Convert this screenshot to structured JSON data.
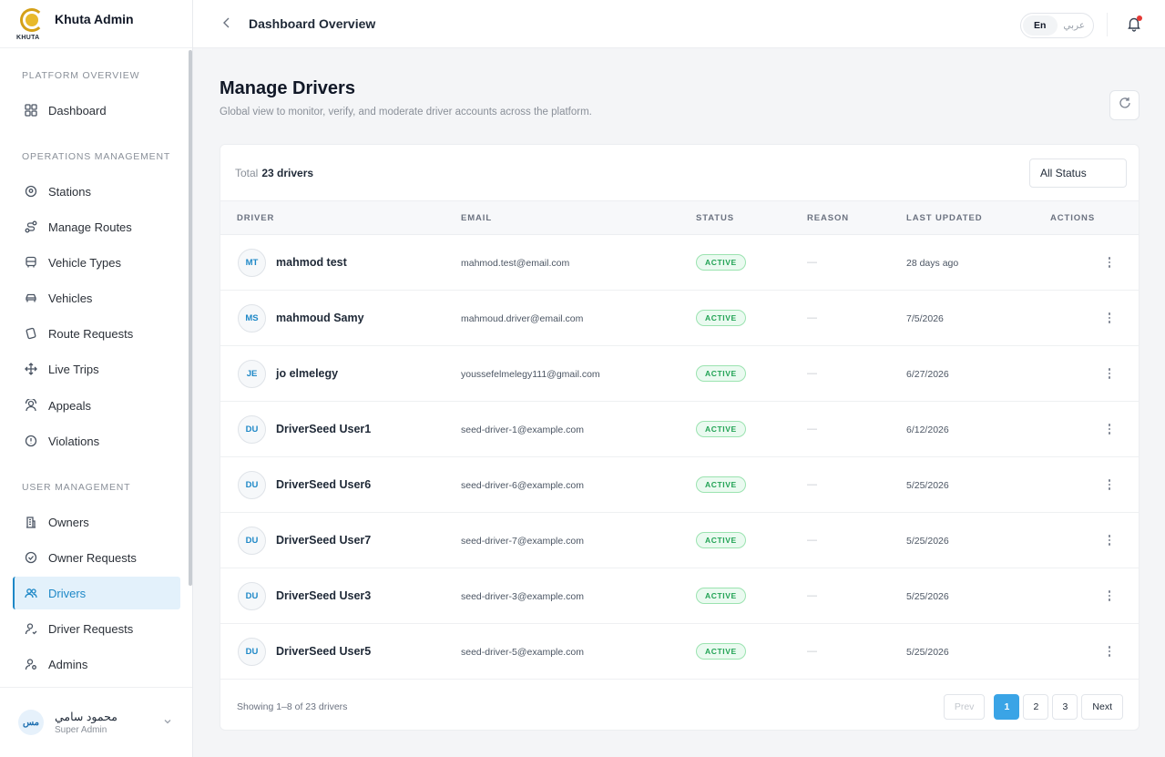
{
  "brand": {
    "title": "Khuta Admin",
    "logo_text": "KHUTA"
  },
  "sidebar": {
    "sections": [
      {
        "label": "PLATFORM OVERVIEW"
      },
      {
        "label": "OPERATIONS MANAGEMENT"
      },
      {
        "label": "USER MANAGEMENT"
      }
    ],
    "items": [
      {
        "label": "Dashboard",
        "icon": "grid-icon"
      },
      {
        "label": "Stations",
        "icon": "map-pin-icon"
      },
      {
        "label": "Manage Routes",
        "icon": "route-icon"
      },
      {
        "label": "Vehicle Types",
        "icon": "bus-icon"
      },
      {
        "label": "Vehicles",
        "icon": "car-icon"
      },
      {
        "label": "Route Requests",
        "icon": "tag-icon"
      },
      {
        "label": "Live Trips",
        "icon": "move-icon"
      },
      {
        "label": "Appeals",
        "icon": "users-ring-icon"
      },
      {
        "label": "Violations",
        "icon": "alert-circle-icon"
      },
      {
        "label": "Owners",
        "icon": "building-icon"
      },
      {
        "label": "Owner Requests",
        "icon": "check-circle-icon"
      },
      {
        "label": "Drivers",
        "icon": "users-icon",
        "active": true
      },
      {
        "label": "Driver Requests",
        "icon": "user-check-icon"
      },
      {
        "label": "Admins",
        "icon": "user-cog-icon"
      }
    ]
  },
  "user": {
    "initials": "مس",
    "name": "محمود سامي",
    "role": "Super Admin"
  },
  "topbar": {
    "title": "Dashboard Overview",
    "lang_en": "En",
    "lang_ar": "عربي"
  },
  "page": {
    "title": "Manage Drivers",
    "subtitle": "Global view to monitor, verify, and moderate driver accounts across the platform."
  },
  "table": {
    "total_label": "Total",
    "total_value": "23 drivers",
    "filter_value": "All Status",
    "columns": [
      "DRIVER",
      "EMAIL",
      "STATUS",
      "REASON",
      "LAST UPDATED",
      "ACTIONS"
    ],
    "rows": [
      {
        "initials": "MT",
        "name": "mahmod test",
        "email": "mahmod.test@email.com",
        "status": "ACTIVE",
        "reason": "—",
        "updated": "28 days ago"
      },
      {
        "initials": "MS",
        "name": "mahmoud Samy",
        "email": "mahmoud.driver@email.com",
        "status": "ACTIVE",
        "reason": "—",
        "updated": "7/5/2026"
      },
      {
        "initials": "JE",
        "name": "jo elmelegy",
        "email": "youssefelmelegy111@gmail.com",
        "status": "ACTIVE",
        "reason": "—",
        "updated": "6/27/2026"
      },
      {
        "initials": "DU",
        "name": "DriverSeed User1",
        "email": "seed-driver-1@example.com",
        "status": "ACTIVE",
        "reason": "—",
        "updated": "6/12/2026"
      },
      {
        "initials": "DU",
        "name": "DriverSeed User6",
        "email": "seed-driver-6@example.com",
        "status": "ACTIVE",
        "reason": "—",
        "updated": "5/25/2026"
      },
      {
        "initials": "DU",
        "name": "DriverSeed User7",
        "email": "seed-driver-7@example.com",
        "status": "ACTIVE",
        "reason": "—",
        "updated": "5/25/2026"
      },
      {
        "initials": "DU",
        "name": "DriverSeed User3",
        "email": "seed-driver-3@example.com",
        "status": "ACTIVE",
        "reason": "—",
        "updated": "5/25/2026"
      },
      {
        "initials": "DU",
        "name": "DriverSeed User5",
        "email": "seed-driver-5@example.com",
        "status": "ACTIVE",
        "reason": "—",
        "updated": "5/25/2026"
      }
    ],
    "footer_text": "Showing 1–8 of 23 drivers"
  },
  "pagination": {
    "prev": "Prev",
    "pages": [
      "1",
      "2",
      "3"
    ],
    "current": "1",
    "next": "Next"
  },
  "colors": {
    "accent": "#3aa4e6",
    "active_green": "#22a355",
    "notification_dot": "#e53935"
  }
}
